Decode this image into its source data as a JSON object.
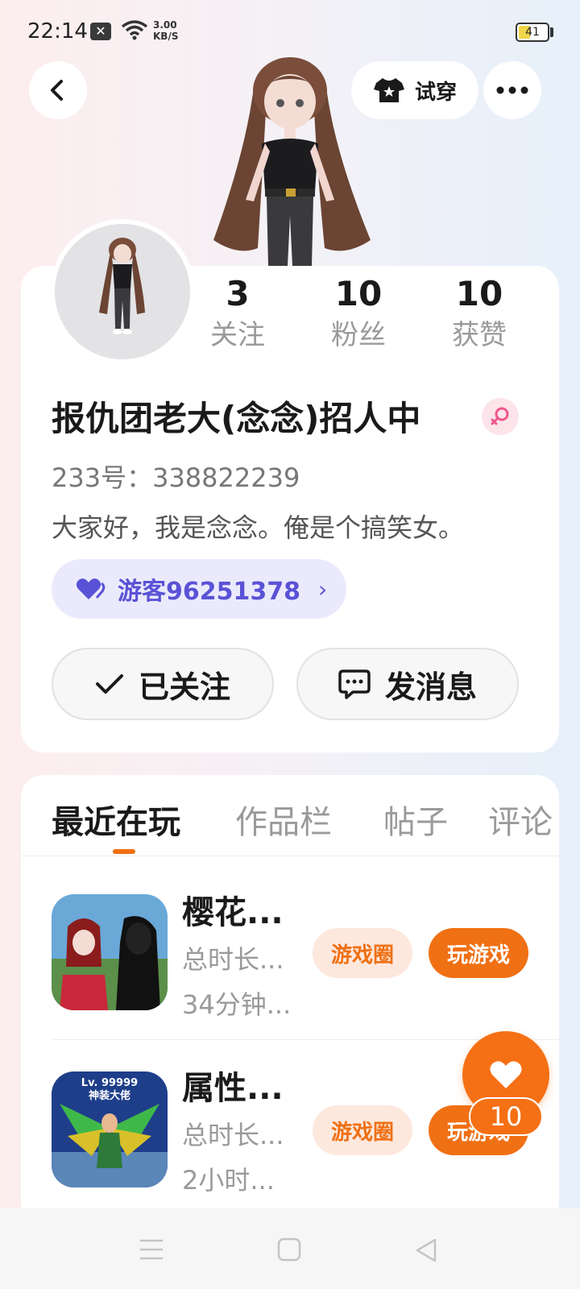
{
  "status_bar": {
    "time": "22:14",
    "network_speed_value": "3.00",
    "network_speed_unit": "KB/S",
    "battery": "41",
    "battery_level": 0.41
  },
  "header": {
    "try_on_label": "试穿",
    "icons": [
      "back-arrow-icon",
      "tshirt-icon",
      "more-icon"
    ]
  },
  "profile": {
    "stats": [
      {
        "value": "3",
        "label": "关注"
      },
      {
        "value": "10",
        "label": "粉丝"
      },
      {
        "value": "10",
        "label": "获赞"
      }
    ],
    "username": "报仇团老大(念念)招人中",
    "gender_icon": "female-icon",
    "uid": "233号：338822239",
    "bio": "大家好，我是念念。俺是个搞笑女。",
    "guest_label": "游客96251378",
    "follow_label": "已关注",
    "message_label": "发消息"
  },
  "tabs": [
    "最近在玩",
    "作品栏",
    "帖子",
    "评论"
  ],
  "active_tab": 0,
  "games": [
    {
      "title": "樱花...",
      "duration_label": "总时长...",
      "duration_value": "34分钟...",
      "circle_label": "游戏圈",
      "play_label": "玩游戏"
    },
    {
      "title": "属性...",
      "duration_label": "总时长...",
      "duration_value": "2小时...",
      "circle_label": "游戏圈",
      "play_label": "玩游戏",
      "icon_text_1": "Lv. 99999",
      "icon_text_2": "神装大佬"
    }
  ],
  "like_fab": {
    "count": "10"
  },
  "colors": {
    "accent": "#f07014",
    "guest": "#5a52d6",
    "guest_bg": "#ebeafc"
  }
}
